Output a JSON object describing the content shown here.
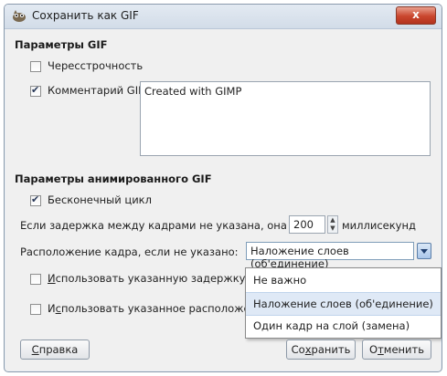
{
  "window": {
    "title": "Сохранить как GIF",
    "close_label": "x"
  },
  "gif_params": {
    "section_title": "Параметры GIF",
    "interlace": {
      "label": "Чересстрочность",
      "checked": false
    },
    "comment": {
      "label": "Комментарий GIF:",
      "checked": true,
      "value": "Created with GIMP"
    }
  },
  "anim_params": {
    "section_title": "Параметры анимированного GIF",
    "loop": {
      "label": "Бесконечный цикл",
      "checked": true
    },
    "delay": {
      "label": "Если задержка между кадрами не указана, она равна:",
      "value": "200",
      "unit": "миллисекунд"
    },
    "disposal": {
      "label": "Расположение кадра, если не указано:",
      "selected": "Наложение слоев (об'единение)",
      "options": [
        "Не важно",
        "Наложение слоев (об'единение)",
        "Один кадр на слой (замена)"
      ],
      "highlighted_index": 1
    },
    "use_delay": {
      "label_mnemonic": "И",
      "label_rest": "спользовать указанную задержку в",
      "checked": false
    },
    "use_disposal": {
      "label_prefix": "И",
      "label_mnemonic": "с",
      "label_rest": "пользовать указанное расположе",
      "checked": false
    }
  },
  "buttons": {
    "help": {
      "mnemonic": "С",
      "rest": "правка"
    },
    "save": {
      "prefix": "Со",
      "mnemonic": "х",
      "rest": "ранить"
    },
    "cancel": {
      "prefix": "О",
      "mnemonic": "т",
      "rest": "менить"
    }
  }
}
